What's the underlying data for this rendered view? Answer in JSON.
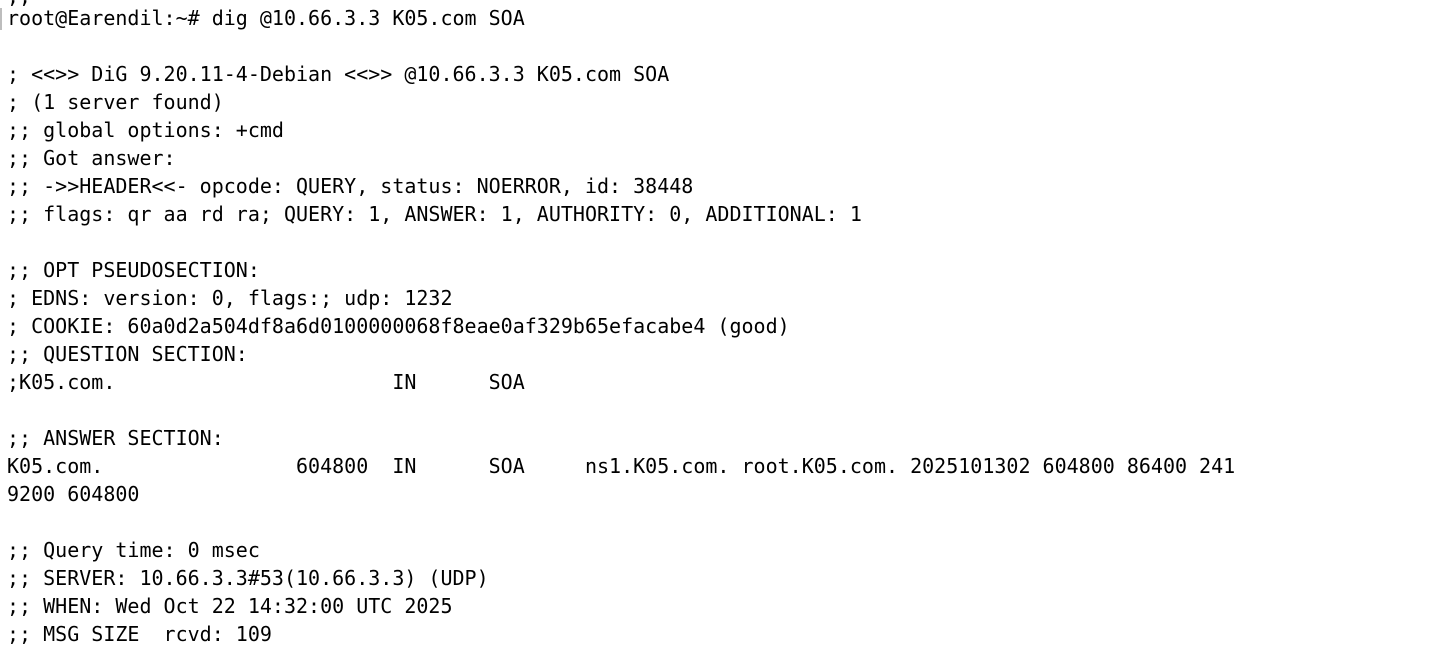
{
  "terminal": {
    "clipped_top_fragment": ";;",
    "lines": [
      "root@Earendil:~# dig @10.66.3.3 K05.com SOA",
      "",
      "; <<>> DiG 9.20.11-4-Debian <<>> @10.66.3.3 K05.com SOA",
      "; (1 server found)",
      ";; global options: +cmd",
      ";; Got answer:",
      ";; ->>HEADER<<- opcode: QUERY, status: NOERROR, id: 38448",
      ";; flags: qr aa rd ra; QUERY: 1, ANSWER: 1, AUTHORITY: 0, ADDITIONAL: 1",
      "",
      ";; OPT PSEUDOSECTION:",
      "; EDNS: version: 0, flags:; udp: 1232",
      "; COOKIE: 60a0d2a504df8a6d0100000068f8eae0af329b65efacabe4 (good)",
      ";; QUESTION SECTION:",
      ";K05.com.                       IN      SOA",
      "",
      ";; ANSWER SECTION:",
      "K05.com.                604800  IN      SOA     ns1.K05.com. root.K05.com. 2025101302 604800 86400 241",
      "9200 604800",
      "",
      ";; Query time: 0 msec",
      ";; SERVER: 10.66.3.3#53(10.66.3.3) (UDP)",
      ";; WHEN: Wed Oct 22 14:32:00 UTC 2025",
      ";; MSG SIZE  rcvd: 109"
    ]
  },
  "colors": {
    "background": "#ffffff",
    "text": "#000000",
    "cursor": "#bdbdbd"
  }
}
